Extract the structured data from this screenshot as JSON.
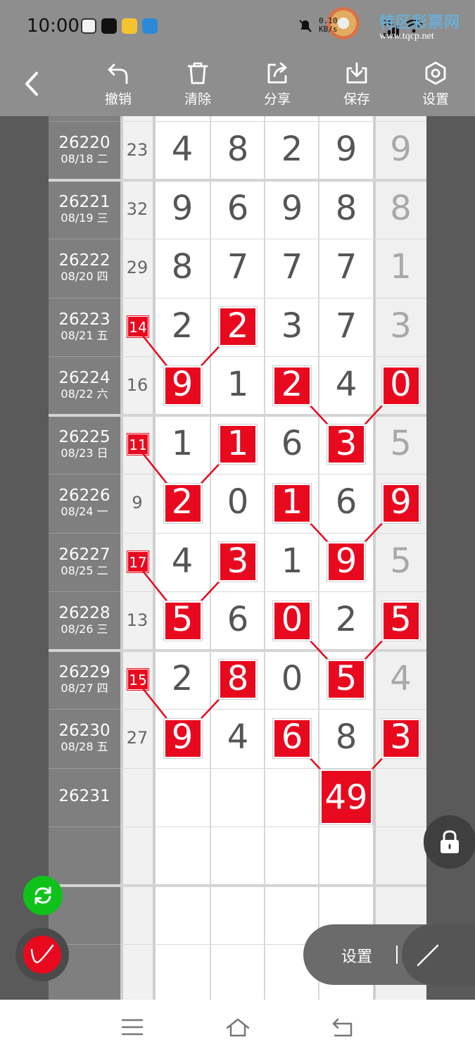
{
  "status_bar": {
    "time": "10:00",
    "net_speed_line1": "0.10",
    "net_speed_line2": "KB/s",
    "network": "5G",
    "watermark_brand": "特区彩票网",
    "watermark_url": "www.tqcp.net"
  },
  "toolbar": {
    "back_icon": "chevron-left-icon",
    "items": [
      {
        "label": "撤销",
        "icon": "undo-icon"
      },
      {
        "label": "清除",
        "icon": "trash-icon"
      },
      {
        "label": "分享",
        "icon": "share-icon"
      },
      {
        "label": "保存",
        "icon": "download-icon"
      },
      {
        "label": "设置",
        "icon": "hexagon-settings-icon"
      }
    ]
  },
  "rows": [
    {
      "issue": "26220",
      "date": "08/18 二",
      "sum": "23",
      "sum_marked": false,
      "digits": [
        "4",
        "8",
        "2",
        "9",
        "9"
      ],
      "marked": []
    },
    {
      "issue": "26221",
      "date": "08/19 三",
      "sum": "32",
      "sum_marked": false,
      "digits": [
        "9",
        "6",
        "9",
        "8",
        "8"
      ],
      "marked": []
    },
    {
      "issue": "26222",
      "date": "08/20 四",
      "sum": "29",
      "sum_marked": false,
      "digits": [
        "8",
        "7",
        "7",
        "7",
        "1"
      ],
      "marked": []
    },
    {
      "issue": "26223",
      "date": "08/21 五",
      "sum": "14",
      "sum_marked": true,
      "digits": [
        "2",
        "2",
        "3",
        "7",
        "3"
      ],
      "marked": [
        1
      ]
    },
    {
      "issue": "26224",
      "date": "08/22 六",
      "sum": "16",
      "sum_marked": false,
      "digits": [
        "9",
        "1",
        "2",
        "4",
        "0"
      ],
      "marked": [
        0,
        2,
        4
      ]
    },
    {
      "issue": "26225",
      "date": "08/23 日",
      "sum": "11",
      "sum_marked": true,
      "digits": [
        "1",
        "1",
        "6",
        "3",
        "5"
      ],
      "marked": [
        1,
        3
      ]
    },
    {
      "issue": "26226",
      "date": "08/24 一",
      "sum": "9",
      "sum_marked": false,
      "digits": [
        "2",
        "0",
        "1",
        "6",
        "9"
      ],
      "marked": [
        0,
        2,
        4
      ]
    },
    {
      "issue": "26227",
      "date": "08/25 二",
      "sum": "17",
      "sum_marked": true,
      "digits": [
        "4",
        "3",
        "1",
        "9",
        "5"
      ],
      "marked": [
        1,
        3
      ]
    },
    {
      "issue": "26228",
      "date": "08/26 三",
      "sum": "13",
      "sum_marked": false,
      "digits": [
        "5",
        "6",
        "0",
        "2",
        "5"
      ],
      "marked": [
        0,
        2,
        4
      ]
    },
    {
      "issue": "26229",
      "date": "08/27 四",
      "sum": "15",
      "sum_marked": true,
      "digits": [
        "2",
        "8",
        "0",
        "5",
        "4"
      ],
      "marked": [
        1,
        3
      ]
    },
    {
      "issue": "26230",
      "date": "08/28 五",
      "sum": "27",
      "sum_marked": false,
      "digits": [
        "9",
        "4",
        "6",
        "8",
        "3"
      ],
      "marked": [
        0,
        2,
        4
      ]
    },
    {
      "issue": "26231",
      "date": "",
      "sum": "",
      "sum_marked": false,
      "digits": [
        "",
        "",
        "",
        "",
        ""
      ],
      "marked": []
    }
  ],
  "prediction": {
    "value": "49",
    "column": 3
  },
  "floating": {
    "lock_icon": "lock-icon",
    "refresh_icon": "refresh-icon",
    "pen_icon": "pen-icon",
    "pill_label": "设置",
    "draw_icon": "line-tool-icon"
  },
  "nav": {
    "menu_icon": "menu-icon",
    "home_icon": "home-icon",
    "back_icon": "back-icon"
  },
  "colors": {
    "mark_red": "#e8091f",
    "toolbar_gray": "#8e8e8e",
    "refresh_green": "#0ec21a"
  }
}
